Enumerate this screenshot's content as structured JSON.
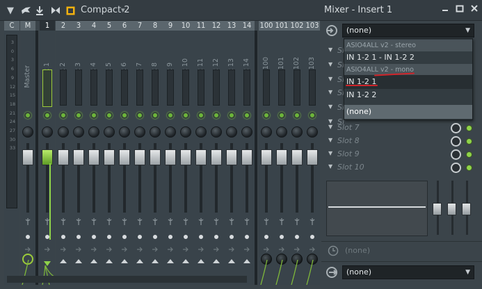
{
  "titlebar": {
    "preset_name": "Compact 2",
    "window_title": "Mixer - Insert 1"
  },
  "headers": [
    "C",
    "M",
    "1",
    "2",
    "3",
    "4",
    "5",
    "6",
    "7",
    "8",
    "9",
    "10",
    "11",
    "12",
    "13",
    "14",
    "100",
    "101",
    "102",
    "103"
  ],
  "track_names": [
    "Master",
    "Insert 1",
    "Insert 2",
    "Insert 3",
    "Insert 4",
    "Insert 5",
    "Insert 6",
    "Insert 7",
    "Insert 8",
    "Insert 9",
    "Insert 10",
    "Insert 11",
    "Insert 12",
    "Insert 13",
    "Insert 14",
    "Inse. 100",
    "Inse. 101",
    "Inse. 102",
    "Inse. 103"
  ],
  "db_scale": [
    "3",
    "0",
    "3",
    "6",
    "9",
    "12",
    "15",
    "18",
    "21",
    "24",
    "27",
    "30",
    "33"
  ],
  "panel": {
    "input_value": "(none)",
    "slot_prefix": "Sl",
    "slots": [
      "Slot 7",
      "Slot 8",
      "Slot 9",
      "Slot 10"
    ],
    "routing_value": "(none)",
    "output_value": "(none)"
  },
  "dropdown": {
    "group_stereo": "ASIO4ALL v2 - stereo",
    "stereo_item": "IN 1-2 1 - IN 1-2 2",
    "group_mono": "ASIO4ALL v2 - mono",
    "mono_item_1": "IN 1-2 1",
    "mono_item_2": "IN 1-2 2",
    "none_item": "(none)"
  },
  "colors": {
    "accent_green": "#8fd34a",
    "annotation_red": "#d0242a"
  }
}
